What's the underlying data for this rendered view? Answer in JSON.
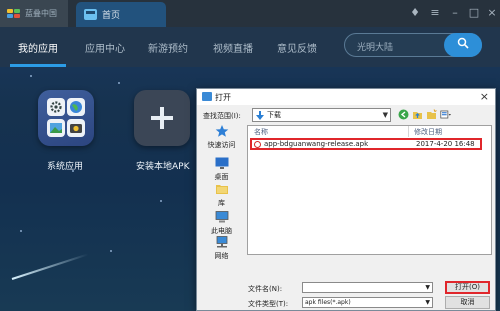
{
  "titlebar": {
    "app_tab_label": "蓝叠中国",
    "home_tab_label": "首页"
  },
  "nav": {
    "items": [
      "我的应用",
      "应用中心",
      "新游预约",
      "视频直播",
      "意见反馈"
    ],
    "search_placeholder": "光明大陆"
  },
  "desktop": {
    "apps": [
      {
        "label": "系统应用"
      },
      {
        "label": "安装本地APK"
      }
    ]
  },
  "dialog": {
    "title": "打开",
    "look_in_label": "查找范围(I):",
    "look_in_value": "下载",
    "places": [
      "快速访问",
      "桌面",
      "库",
      "此电脑",
      "网络"
    ],
    "columns": {
      "name": "名称",
      "modified": "修改日期"
    },
    "files": [
      {
        "name": "app-bdguanwang-release.apk",
        "modified": "2017-4-20 16:48"
      }
    ],
    "filename_label": "文件名(N):",
    "filename_value": "",
    "filetype_label": "文件类型(T):",
    "filetype_value": "apk files(*.apk)",
    "open_button": "打开(O)",
    "cancel_button": "取消"
  },
  "colors": {
    "accent": "#2c9ce6",
    "highlight_border": "#e0262b"
  }
}
